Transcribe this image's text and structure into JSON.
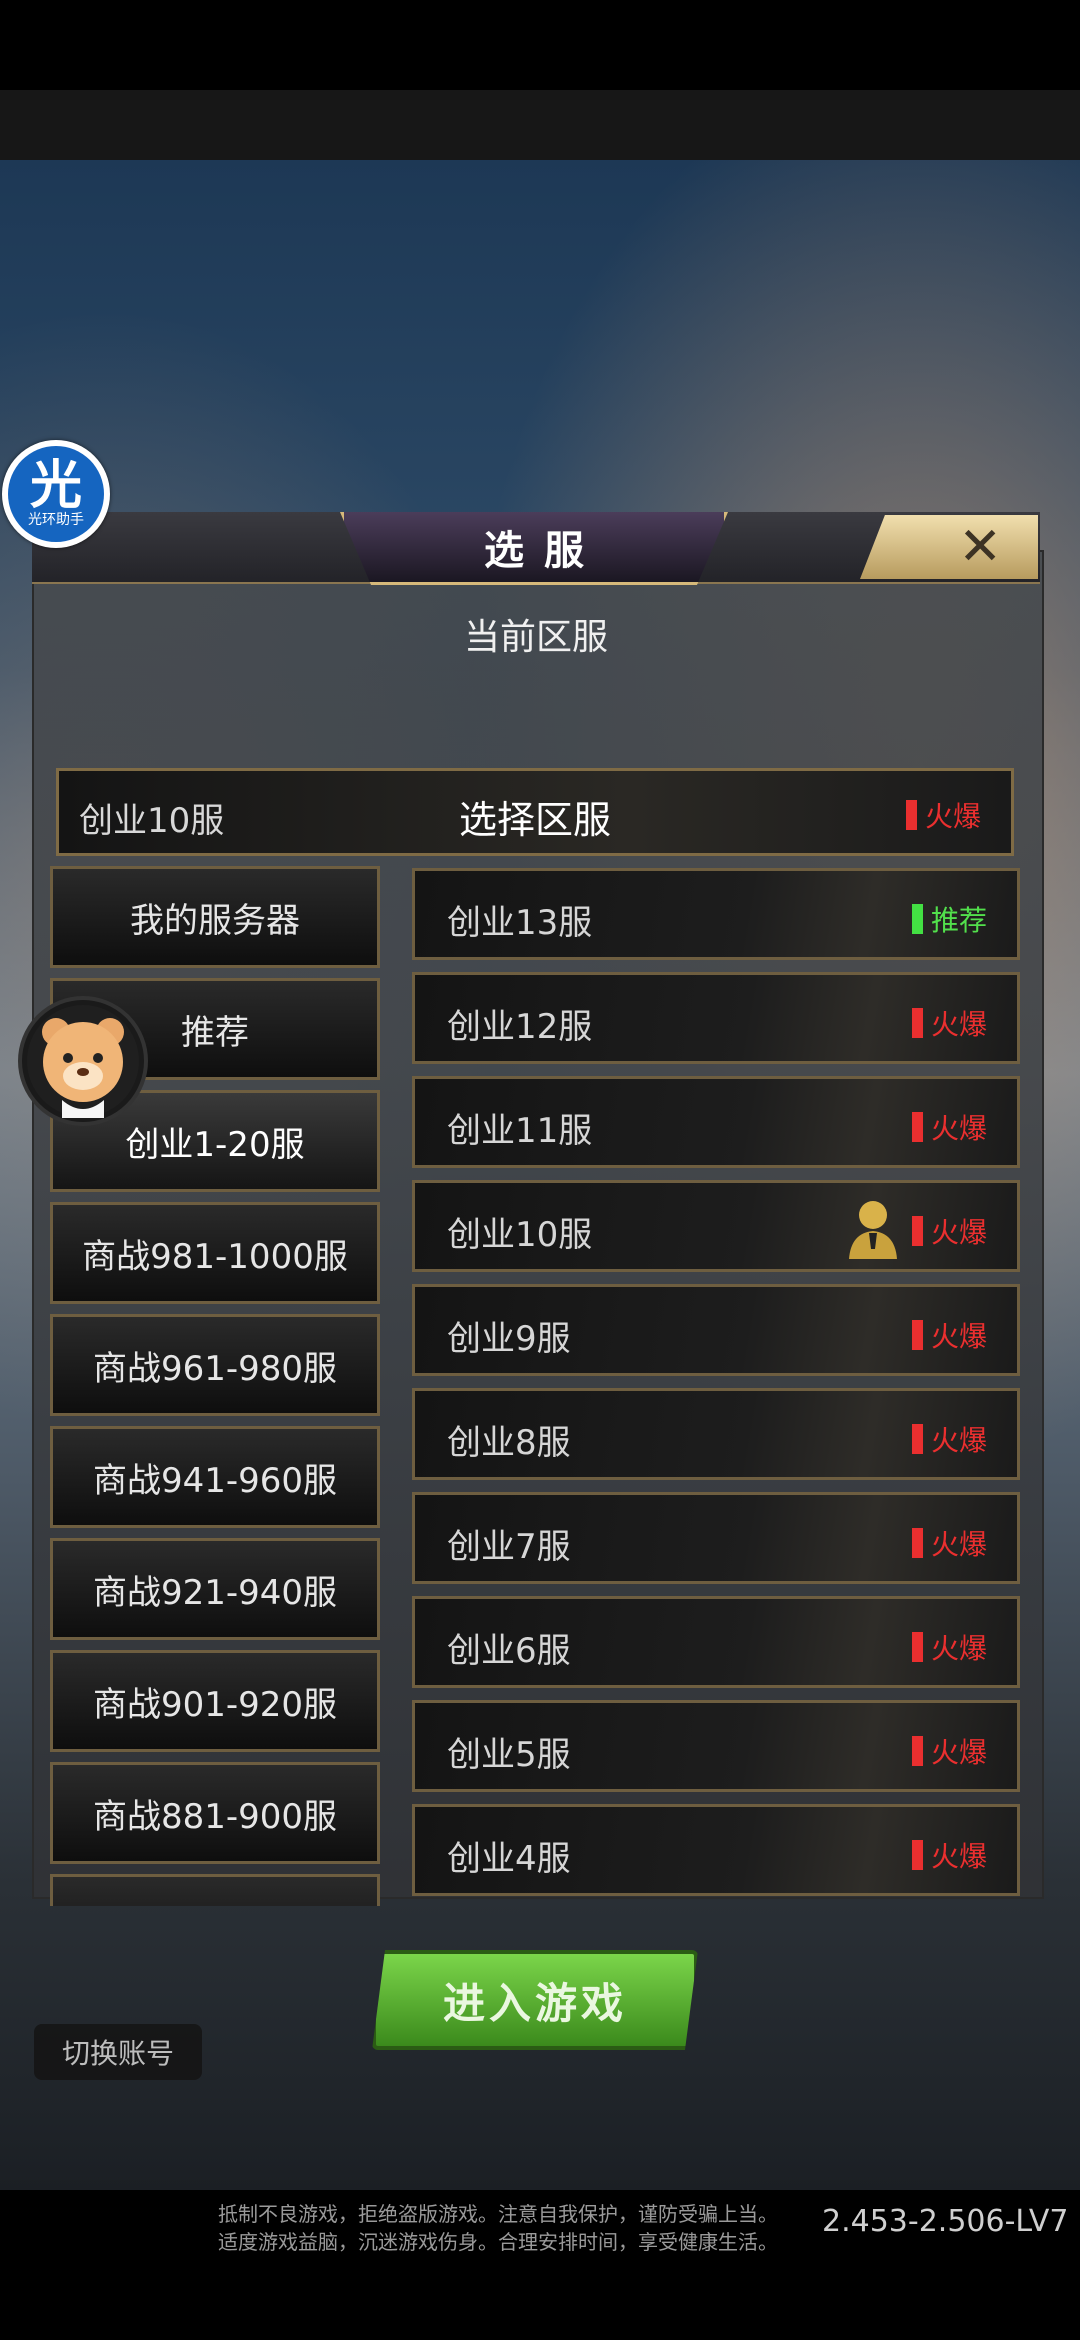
{
  "helper": {
    "glyph": "光",
    "label": "光环助手"
  },
  "dialog": {
    "title": "选服",
    "close_glyph": "✕",
    "current_label": "当前区服",
    "current_server": "创业10服",
    "select_title": "选择区服",
    "current_status": "火爆"
  },
  "left_items": [
    {
      "label": "我的服务器"
    },
    {
      "label": "推荐"
    },
    {
      "label": "创业1-20服"
    },
    {
      "label": "商战981-1000服"
    },
    {
      "label": "商战961-980服"
    },
    {
      "label": "商战941-960服"
    },
    {
      "label": "商战921-940服"
    },
    {
      "label": "商战901-920服"
    },
    {
      "label": "商战881-900服"
    }
  ],
  "servers": [
    {
      "name": "创业13服",
      "status": "推荐",
      "kind": "rec"
    },
    {
      "name": "创业12服",
      "status": "火爆",
      "kind": "hot"
    },
    {
      "name": "创业11服",
      "status": "火爆",
      "kind": "hot"
    },
    {
      "name": "创业10服",
      "status": "火爆",
      "kind": "hot",
      "has_avatar": true
    },
    {
      "name": "创业9服",
      "status": "火爆",
      "kind": "hot"
    },
    {
      "name": "创业8服",
      "status": "火爆",
      "kind": "hot"
    },
    {
      "name": "创业7服",
      "status": "火爆",
      "kind": "hot"
    },
    {
      "name": "创业6服",
      "status": "火爆",
      "kind": "hot"
    },
    {
      "name": "创业5服",
      "status": "火爆",
      "kind": "hot"
    },
    {
      "name": "创业4服",
      "status": "火爆",
      "kind": "hot"
    }
  ],
  "buttons": {
    "enter_game": "进入游戏",
    "switch_account": "切换账号"
  },
  "footer": {
    "notice_line1": "抵制不良游戏，拒绝盗版游戏。注意自我保护，谨防受骗上当。",
    "notice_line2": "适度游戏益脑，沉迷游戏伤身。合理安排时间，享受健康生活。",
    "version": "2.453-2.506-LV7"
  }
}
